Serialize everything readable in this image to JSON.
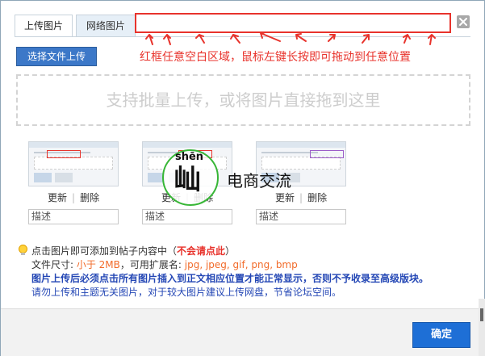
{
  "tabs": [
    {
      "label": "上传图片",
      "active": true
    },
    {
      "label": "网络图片",
      "active": false
    }
  ],
  "close_label": "×",
  "red_note": "红框任意空白区域，鼠标左键长按即可拖动到任意位置",
  "select_button": "选择文件上传",
  "dropzone_text": "支持批量上传，或将图片直接拖到这里",
  "thumbnails": [
    {
      "edit": "更新",
      "sep": "|",
      "delete": "删除",
      "desc_placeholder": "描述"
    },
    {
      "edit": "更新",
      "sep": "|",
      "delete": "删除",
      "desc_placeholder": "描述"
    },
    {
      "edit": "更新",
      "sep": "|",
      "delete": "删除",
      "desc_placeholder": "描述"
    }
  ],
  "watermark": {
    "pinyin": "shēn",
    "glyph": "屾",
    "text": "电商交流"
  },
  "info": {
    "line1_prefix": "点击图片即可添加到帖子内容中（",
    "line1_highlight": "不会请点此",
    "line1_suffix": "）",
    "line2_prefix": "文件尺寸: ",
    "line2_size": "小于 2MB",
    "line2_mid": "，可用扩展名: ",
    "line2_ext": "jpg, jpeg, gif, png, bmp",
    "line3": "图片上传后必须点击所有图片插入到正文相应位置才能正常显示，否则不予收录至高级版块。",
    "line4": "请勿上传和主题无关图片，对于较大图片建议上传网盘，节省论坛空间。"
  },
  "ok_button": "确定",
  "colors": {
    "accent_red": "#e8332c",
    "button_blue": "#1e6fd6",
    "info_blue": "#2447b5",
    "orange": "#f26b2a"
  }
}
